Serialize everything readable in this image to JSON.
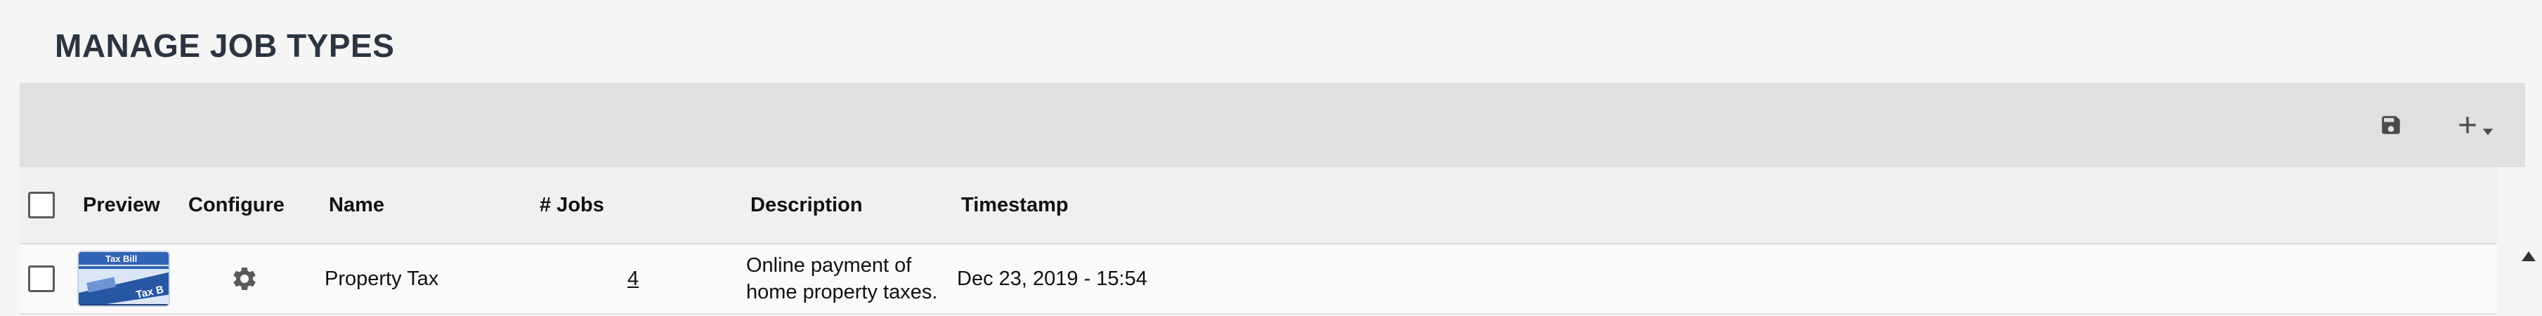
{
  "page": {
    "title": "MANAGE JOB TYPES"
  },
  "toolbar": {
    "save_icon": "save-icon",
    "add_icon": "plus-icon",
    "dropdown_icon": "caret-down-icon"
  },
  "table": {
    "columns": {
      "preview": "Preview",
      "configure": "Configure",
      "name": "Name",
      "jobs": "# Jobs",
      "description": "Description",
      "timestamp": "Timestamp"
    },
    "rows": [
      {
        "preview_icon": "tax-bill-thumbnail",
        "thumbnail_text": [
          "Tax Bill",
          "Tax B"
        ],
        "configure_icon": "gear-icon",
        "name": "Property Tax",
        "jobs": "4",
        "description_line1": "Online payment of",
        "description_line2": "home property taxes.",
        "timestamp": "Dec 23, 2019 - 15:54"
      }
    ]
  },
  "colors": {
    "toolbar_bg": "#e0e0e0",
    "header_bg": "#f0f0f0",
    "title": "#2b3440",
    "icon": "#4a4a4a"
  }
}
